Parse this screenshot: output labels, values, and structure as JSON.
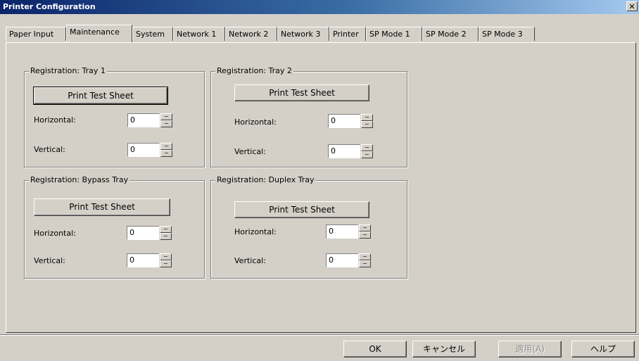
{
  "window": {
    "title": "Printer Configuration",
    "close_glyph": "✕"
  },
  "tabs": [
    {
      "label": "Paper Input"
    },
    {
      "label": "Maintenance"
    },
    {
      "label": "System"
    },
    {
      "label": "Network 1"
    },
    {
      "label": "Network 2"
    },
    {
      "label": "Network 3"
    },
    {
      "label": "Printer"
    },
    {
      "label": "SP Mode 1"
    },
    {
      "label": "SP Mode 2"
    },
    {
      "label": "SP Mode 3"
    }
  ],
  "active_tab": "Maintenance",
  "groups": {
    "tray1": {
      "title": "Registration: Tray 1"
    },
    "tray2": {
      "title": "Registration: Tray 2"
    },
    "bypass": {
      "title": "Registration: Bypass Tray"
    },
    "duplex": {
      "title": "Registration: Duplex Tray"
    }
  },
  "common": {
    "print_test_sheet": "Print Test Sheet",
    "horizontal": "Horizontal:",
    "vertical": "Vertical:"
  },
  "values": {
    "tray1": {
      "horizontal": "0",
      "vertical": "0"
    },
    "tray2": {
      "horizontal": "0",
      "vertical": "0"
    },
    "bypass": {
      "horizontal": "0",
      "vertical": "0"
    },
    "duplex": {
      "horizontal": "0",
      "vertical": "0"
    }
  },
  "footer": {
    "ok": "OK",
    "cancel": "キャンセル",
    "apply": "適用(A)",
    "help": "ヘルプ"
  }
}
